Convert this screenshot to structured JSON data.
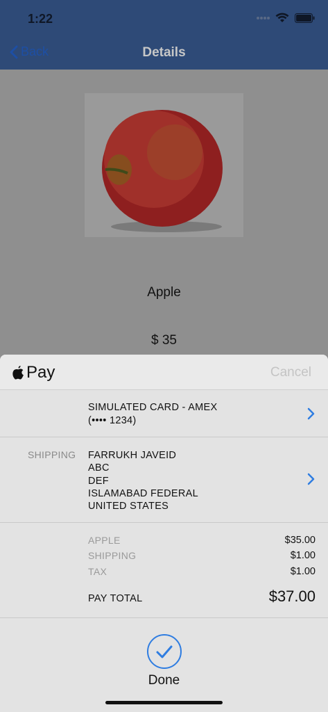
{
  "status": {
    "time": "1:22"
  },
  "nav": {
    "back_label": "Back",
    "title": "Details"
  },
  "product": {
    "name": "Apple",
    "price": "$ 35"
  },
  "sheet": {
    "pay_label": "Pay",
    "cancel_label": "Cancel",
    "card": {
      "line1": "SIMULATED CARD - AMEX",
      "line2": "(•••• 1234)"
    },
    "shipping": {
      "label": "SHIPPING",
      "lines": [
        "FARRUKH JAVEID",
        "ABC",
        "DEF",
        "ISLAMABAD FEDERAL",
        "UNITED STATES"
      ]
    },
    "summary": [
      {
        "label": "APPLE",
        "value": "$35.00"
      },
      {
        "label": "SHIPPING",
        "value": "$1.00"
      },
      {
        "label": "TAX",
        "value": "$1.00"
      }
    ],
    "total": {
      "label": "PAY TOTAL",
      "value": "$37.00"
    },
    "done_label": "Done"
  },
  "colors": {
    "nav_bg": "#2e4a77",
    "accent": "#2f7de1",
    "sheet_bg": "#e3e3e3"
  }
}
